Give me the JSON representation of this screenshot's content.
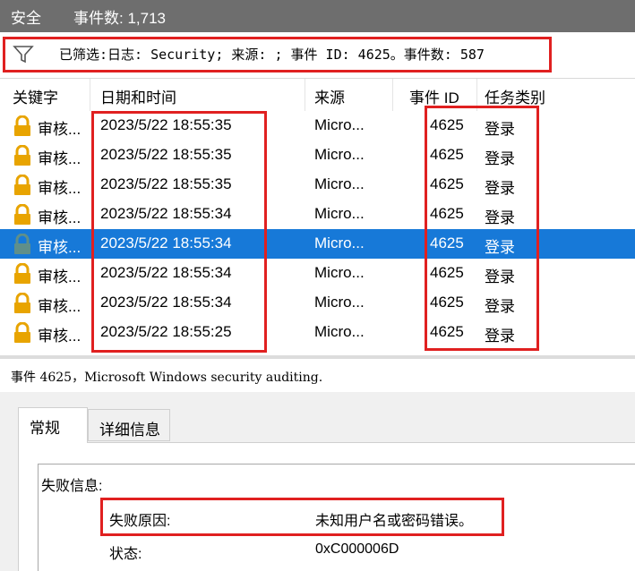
{
  "titlebar": {
    "log_name": "安全",
    "event_count": "事件数: 1,713"
  },
  "filter": {
    "text": "已筛选:日志: Security; 来源: ; 事件 ID: 4625。事件数: 587"
  },
  "columns": {
    "keyword": "关键字",
    "datetime": "日期和时间",
    "source": "来源",
    "event_id": "事件 ID",
    "task": "任务类别"
  },
  "rows": [
    {
      "keyword": "审核...",
      "datetime": "2023/5/22 18:55:35",
      "source": "Micro...",
      "event_id": "4625",
      "task": "登录"
    },
    {
      "keyword": "审核...",
      "datetime": "2023/5/22 18:55:35",
      "source": "Micro...",
      "event_id": "4625",
      "task": "登录"
    },
    {
      "keyword": "审核...",
      "datetime": "2023/5/22 18:55:35",
      "source": "Micro...",
      "event_id": "4625",
      "task": "登录"
    },
    {
      "keyword": "审核...",
      "datetime": "2023/5/22 18:55:34",
      "source": "Micro...",
      "event_id": "4625",
      "task": "登录"
    },
    {
      "keyword": "审核...",
      "datetime": "2023/5/22 18:55:34",
      "source": "Micro...",
      "event_id": "4625",
      "task": "登录"
    },
    {
      "keyword": "审核...",
      "datetime": "2023/5/22 18:55:34",
      "source": "Micro...",
      "event_id": "4625",
      "task": "登录"
    },
    {
      "keyword": "审核...",
      "datetime": "2023/5/22 18:55:34",
      "source": "Micro...",
      "event_id": "4625",
      "task": "登录"
    },
    {
      "keyword": "审核...",
      "datetime": "2023/5/22 18:55:25",
      "source": "Micro...",
      "event_id": "4625",
      "task": "登录"
    }
  ],
  "selected_row": 4,
  "detail": {
    "header": "事件 4625，Microsoft Windows security auditing.",
    "tabs": {
      "general": "常规",
      "details": "详细信息"
    },
    "failure_info_label": "失败信息:",
    "failure_reason_label": "失败原因:",
    "failure_reason_value": "未知用户名或密码错误。",
    "status_label": "状态:",
    "status_value": "0xC000006D"
  },
  "icons": {
    "filter": "funnel-icon",
    "lock": "lock-icon"
  },
  "colors": {
    "selection": "#1779d8",
    "highlight_box": "#e02020",
    "lock_gold": "#e8a400",
    "lock_selected": "#5f8f8a"
  }
}
